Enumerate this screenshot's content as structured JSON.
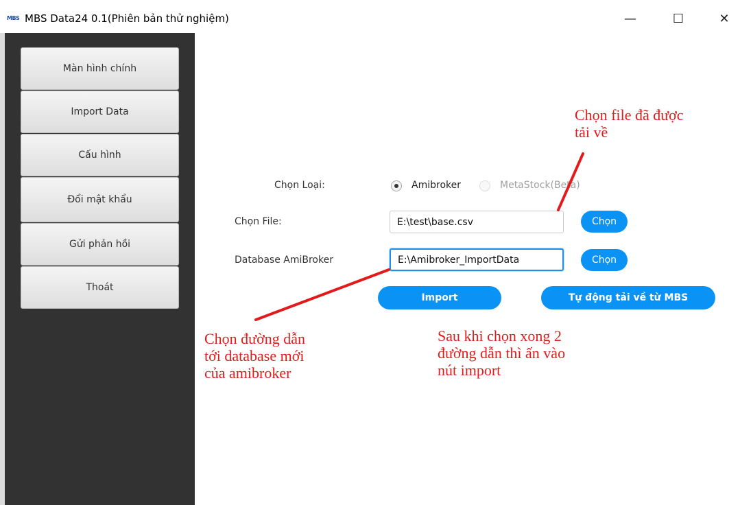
{
  "window": {
    "logo_text": "MBS",
    "title": "MBS Data24 0.1(Phiên bản thử nghiệm)",
    "minimize_glyph": "—",
    "maximize_glyph": "☐",
    "close_glyph": "✕"
  },
  "sidebar": {
    "items": [
      {
        "label": "Màn hình chính"
      },
      {
        "label": "Import Data"
      },
      {
        "label": "Cấu hình"
      },
      {
        "label": "Đổi mật khẩu"
      },
      {
        "label": "Gửi phản hồi"
      },
      {
        "label": "Thoát"
      }
    ]
  },
  "form": {
    "type_label": "Chọn Loại:",
    "type_options": [
      {
        "label": "Amibroker",
        "selected": true
      },
      {
        "label": "MetaStock(Beta)",
        "selected": false
      }
    ],
    "file_label": "Chọn File:",
    "file_value": "E:\\test\\base.csv",
    "file_button": "Chọn",
    "db_label": "Database AmiBroker",
    "db_value": "E:\\Amibroker_ImportData",
    "db_button": "Chọn",
    "import_button": "Import",
    "auto_download_button": "Tự động tải về từ MBS"
  },
  "annotations": {
    "choose_file": "Chọn file đã được\ntải về",
    "choose_db": "Chọn đường dẫn\ntới database mới\ncủa amibroker",
    "after_choose": "Sau khi chọn xong 2\nđường dẫn thì ấn vào\nnút import",
    "color": "#e11b1b"
  }
}
